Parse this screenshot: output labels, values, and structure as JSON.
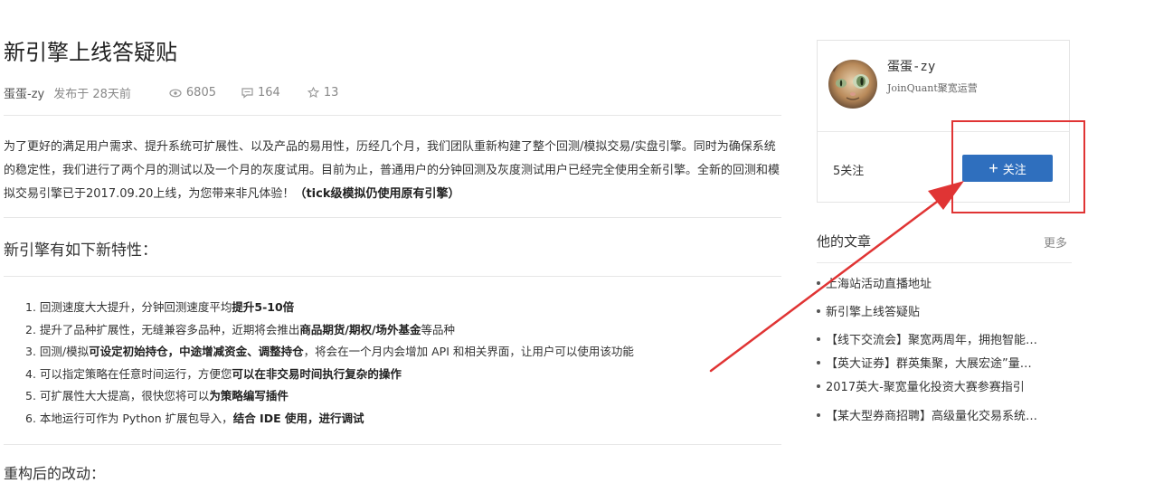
{
  "post": {
    "title": "新引擎上线答疑贴",
    "author": "蛋蛋-zy",
    "published": "发布于 28天前",
    "views": "6805",
    "comments": "164",
    "stars": "13"
  },
  "intro": {
    "text": "为了更好的满足用户需求、提升系统可扩展性、以及产品的易用性，历经几个月，我们团队重新构建了整个回测/模拟交易/实盘引擎。同时为确保系统的稳定性，我们进行了两个月的测试以及一个月的灰度试用。目前为止，普通用户的分钟回测及灰度测试用户已经完全使用全新引擎。全新的回测和模拟交易引擎已于2017.09.20上线，为您带来非凡体验！",
    "bold": "（tick级模拟仍使用原有引擎）"
  },
  "section_heading": "新引擎有如下新特性：",
  "features": [
    {
      "pre": "1. 回测速度大大提升，分钟回测速度平均",
      "bold": "提升5-10倍",
      "post": ""
    },
    {
      "pre": "2. 提升了品种扩展性，无缝兼容多品种，近期将会推出",
      "bold": "商品期货/期权/场外基金",
      "post": "等品种"
    },
    {
      "pre": "3. 回测/模拟",
      "bold": "可设定初始持仓，中途增减资金、调整持仓",
      "post": "，将会在一个月内会增加 API 和相关界面，让用户可以使用该功能"
    },
    {
      "pre": "4. 可以指定策略在任意时间运行，方便您",
      "bold": "可以在非交易时间执行复杂的操作",
      "post": ""
    },
    {
      "pre": "5. 可扩展性大大提高，很快您将可以",
      "bold": "为策略编写插件",
      "post": ""
    },
    {
      "pre": "6. 本地运行可作为 Python 扩展包导入，",
      "bold": "结合 IDE 使用，进行调试",
      "post": ""
    }
  ],
  "next_heading": "重构后的改动：",
  "sidebar": {
    "user_name": "蛋蛋-zy",
    "user_role": "JoinQuant聚宽运营",
    "follow_count": "5关注",
    "follow_button": "关注",
    "articles_title": "他的文章",
    "more_link": "更多",
    "articles": [
      "上海站活动直播地址",
      "新引擎上线答疑贴",
      "【线下交流会】聚宽两周年，拥抱智能投资",
      "【英大证券】群英集聚，大展宏途”量化大赛",
      "2017英大-聚宽量化投资大赛参赛指引",
      "【某大型券商招聘】高级量化交易系统开发"
    ]
  },
  "colors": {
    "accent": "#2f6fbe",
    "annotation": "#e03434"
  }
}
